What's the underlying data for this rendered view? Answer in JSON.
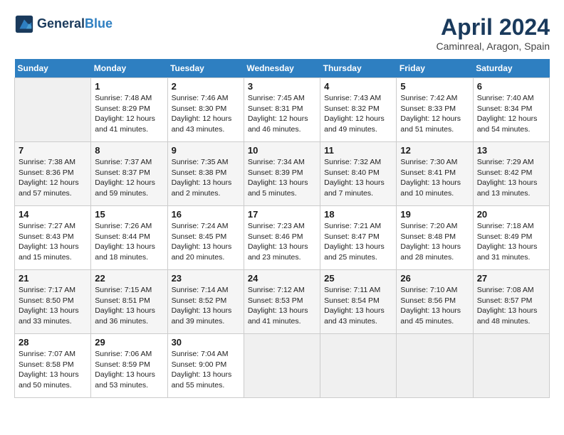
{
  "header": {
    "logo_line1": "General",
    "logo_line2": "Blue",
    "month": "April 2024",
    "location": "Caminreal, Aragon, Spain"
  },
  "weekdays": [
    "Sunday",
    "Monday",
    "Tuesday",
    "Wednesday",
    "Thursday",
    "Friday",
    "Saturday"
  ],
  "weeks": [
    [
      {
        "day": "",
        "info": ""
      },
      {
        "day": "1",
        "info": "Sunrise: 7:48 AM\nSunset: 8:29 PM\nDaylight: 12 hours\nand 41 minutes."
      },
      {
        "day": "2",
        "info": "Sunrise: 7:46 AM\nSunset: 8:30 PM\nDaylight: 12 hours\nand 43 minutes."
      },
      {
        "day": "3",
        "info": "Sunrise: 7:45 AM\nSunset: 8:31 PM\nDaylight: 12 hours\nand 46 minutes."
      },
      {
        "day": "4",
        "info": "Sunrise: 7:43 AM\nSunset: 8:32 PM\nDaylight: 12 hours\nand 49 minutes."
      },
      {
        "day": "5",
        "info": "Sunrise: 7:42 AM\nSunset: 8:33 PM\nDaylight: 12 hours\nand 51 minutes."
      },
      {
        "day": "6",
        "info": "Sunrise: 7:40 AM\nSunset: 8:34 PM\nDaylight: 12 hours\nand 54 minutes."
      }
    ],
    [
      {
        "day": "7",
        "info": "Sunrise: 7:38 AM\nSunset: 8:36 PM\nDaylight: 12 hours\nand 57 minutes."
      },
      {
        "day": "8",
        "info": "Sunrise: 7:37 AM\nSunset: 8:37 PM\nDaylight: 12 hours\nand 59 minutes."
      },
      {
        "day": "9",
        "info": "Sunrise: 7:35 AM\nSunset: 8:38 PM\nDaylight: 13 hours\nand 2 minutes."
      },
      {
        "day": "10",
        "info": "Sunrise: 7:34 AM\nSunset: 8:39 PM\nDaylight: 13 hours\nand 5 minutes."
      },
      {
        "day": "11",
        "info": "Sunrise: 7:32 AM\nSunset: 8:40 PM\nDaylight: 13 hours\nand 7 minutes."
      },
      {
        "day": "12",
        "info": "Sunrise: 7:30 AM\nSunset: 8:41 PM\nDaylight: 13 hours\nand 10 minutes."
      },
      {
        "day": "13",
        "info": "Sunrise: 7:29 AM\nSunset: 8:42 PM\nDaylight: 13 hours\nand 13 minutes."
      }
    ],
    [
      {
        "day": "14",
        "info": "Sunrise: 7:27 AM\nSunset: 8:43 PM\nDaylight: 13 hours\nand 15 minutes."
      },
      {
        "day": "15",
        "info": "Sunrise: 7:26 AM\nSunset: 8:44 PM\nDaylight: 13 hours\nand 18 minutes."
      },
      {
        "day": "16",
        "info": "Sunrise: 7:24 AM\nSunset: 8:45 PM\nDaylight: 13 hours\nand 20 minutes."
      },
      {
        "day": "17",
        "info": "Sunrise: 7:23 AM\nSunset: 8:46 PM\nDaylight: 13 hours\nand 23 minutes."
      },
      {
        "day": "18",
        "info": "Sunrise: 7:21 AM\nSunset: 8:47 PM\nDaylight: 13 hours\nand 25 minutes."
      },
      {
        "day": "19",
        "info": "Sunrise: 7:20 AM\nSunset: 8:48 PM\nDaylight: 13 hours\nand 28 minutes."
      },
      {
        "day": "20",
        "info": "Sunrise: 7:18 AM\nSunset: 8:49 PM\nDaylight: 13 hours\nand 31 minutes."
      }
    ],
    [
      {
        "day": "21",
        "info": "Sunrise: 7:17 AM\nSunset: 8:50 PM\nDaylight: 13 hours\nand 33 minutes."
      },
      {
        "day": "22",
        "info": "Sunrise: 7:15 AM\nSunset: 8:51 PM\nDaylight: 13 hours\nand 36 minutes."
      },
      {
        "day": "23",
        "info": "Sunrise: 7:14 AM\nSunset: 8:52 PM\nDaylight: 13 hours\nand 39 minutes."
      },
      {
        "day": "24",
        "info": "Sunrise: 7:12 AM\nSunset: 8:53 PM\nDaylight: 13 hours\nand 41 minutes."
      },
      {
        "day": "25",
        "info": "Sunrise: 7:11 AM\nSunset: 8:54 PM\nDaylight: 13 hours\nand 43 minutes."
      },
      {
        "day": "26",
        "info": "Sunrise: 7:10 AM\nSunset: 8:56 PM\nDaylight: 13 hours\nand 45 minutes."
      },
      {
        "day": "27",
        "info": "Sunrise: 7:08 AM\nSunset: 8:57 PM\nDaylight: 13 hours\nand 48 minutes."
      }
    ],
    [
      {
        "day": "28",
        "info": "Sunrise: 7:07 AM\nSunset: 8:58 PM\nDaylight: 13 hours\nand 50 minutes."
      },
      {
        "day": "29",
        "info": "Sunrise: 7:06 AM\nSunset: 8:59 PM\nDaylight: 13 hours\nand 53 minutes."
      },
      {
        "day": "30",
        "info": "Sunrise: 7:04 AM\nSunset: 9:00 PM\nDaylight: 13 hours\nand 55 minutes."
      },
      {
        "day": "",
        "info": ""
      },
      {
        "day": "",
        "info": ""
      },
      {
        "day": "",
        "info": ""
      },
      {
        "day": "",
        "info": ""
      }
    ]
  ]
}
